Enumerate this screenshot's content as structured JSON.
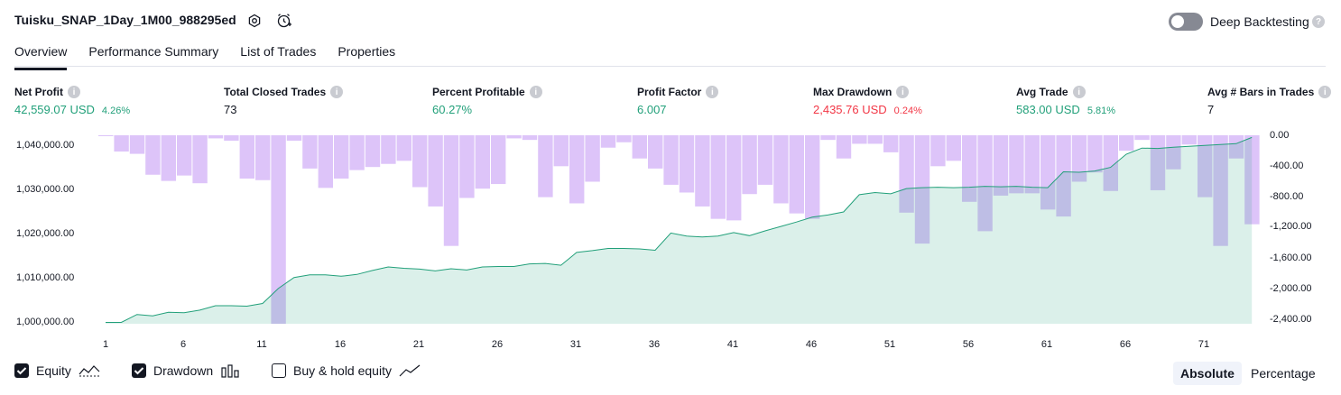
{
  "header": {
    "title": "Tuisku_SNAP_1Day_1M00_988295ed",
    "deep_backtesting_label": "Deep Backtesting",
    "deep_backtesting_on": false
  },
  "tabs": [
    {
      "label": "Overview",
      "active": true
    },
    {
      "label": "Performance Summary",
      "active": false
    },
    {
      "label": "List of Trades",
      "active": false
    },
    {
      "label": "Properties",
      "active": false
    }
  ],
  "metrics": [
    {
      "label": "Net Profit",
      "value": "42,559.07 USD",
      "pct": "4.26%",
      "color": "#22a07a"
    },
    {
      "label": "Total Closed Trades",
      "value": "73",
      "pct": "",
      "color": "#131722"
    },
    {
      "label": "Percent Profitable",
      "value": "60.27%",
      "pct": "",
      "color": "#22a07a"
    },
    {
      "label": "Profit Factor",
      "value": "6.007",
      "pct": "",
      "color": "#22a07a"
    },
    {
      "label": "Max Drawdown",
      "value": "2,435.76 USD",
      "pct": "0.24%",
      "color": "#f23645"
    },
    {
      "label": "Avg Trade",
      "value": "583.00 USD",
      "pct": "5.81%",
      "color": "#22a07a"
    },
    {
      "label": "Avg # Bars in Trades",
      "value": "7",
      "pct": "",
      "color": "#131722"
    }
  ],
  "chart_data": {
    "type": "line",
    "x_ticks": [
      "1",
      "6",
      "11",
      "16",
      "21",
      "26",
      "31",
      "36",
      "41",
      "46",
      "51",
      "56",
      "61",
      "66",
      "71"
    ],
    "y_left_ticks": [
      "1,040,000.00",
      "1,030,000.00",
      "1,020,000.00",
      "1,010,000.00",
      "1,000,000.00"
    ],
    "y_left_range": [
      999700,
      1042500
    ],
    "y_right_ticks": [
      "0.00",
      "-400.00",
      "-800.00",
      "-1,200.00",
      "-1,600.00",
      "-2,000.00",
      "-2,400.00"
    ],
    "y_right_range": [
      -2436,
      0
    ],
    "series": [
      {
        "name": "Equity",
        "color": "#22a07a",
        "x": [
          1,
          2,
          3,
          4,
          5,
          6,
          7,
          8,
          9,
          10,
          11,
          12,
          13,
          14,
          15,
          16,
          17,
          18,
          19,
          20,
          21,
          22,
          23,
          24,
          25,
          26,
          27,
          28,
          29,
          30,
          31,
          32,
          33,
          34,
          35,
          36,
          37,
          38,
          39,
          40,
          41,
          42,
          43,
          44,
          45,
          46,
          47,
          48,
          49,
          50,
          51,
          52,
          53,
          54,
          55,
          56,
          57,
          58,
          59,
          60,
          61,
          62,
          63,
          64,
          65,
          66,
          67,
          68,
          69,
          70,
          71,
          72,
          73,
          74
        ],
        "values": [
          1000000,
          1000000,
          1001800,
          1001500,
          1002300,
          1002200,
          1002800,
          1003800,
          1003800,
          1003700,
          1004300,
          1007700,
          1010200,
          1010800,
          1010800,
          1010500,
          1010900,
          1011800,
          1012600,
          1012300,
          1012100,
          1011700,
          1012200,
          1011900,
          1012600,
          1012700,
          1012700,
          1013300,
          1013400,
          1013000,
          1015900,
          1016300,
          1016800,
          1016800,
          1016700,
          1016400,
          1020300,
          1019600,
          1019400,
          1019600,
          1020400,
          1019700,
          1020800,
          1021800,
          1022800,
          1023900,
          1024400,
          1025100,
          1029000,
          1029500,
          1029200,
          1030400,
          1030600,
          1030700,
          1030600,
          1030700,
          1030900,
          1030800,
          1030900,
          1030700,
          1030600,
          1034200,
          1034100,
          1034400,
          1035200,
          1038200,
          1039600,
          1039500,
          1039800,
          1040000,
          1040200,
          1040400,
          1040600,
          1042000
        ]
      },
      {
        "name": "Drawdown",
        "color": "#c79cf5",
        "x": [
          1,
          2,
          3,
          4,
          5,
          6,
          7,
          8,
          9,
          10,
          11,
          12,
          13,
          14,
          15,
          16,
          17,
          18,
          19,
          20,
          21,
          22,
          23,
          24,
          25,
          26,
          27,
          28,
          29,
          30,
          31,
          32,
          33,
          34,
          35,
          36,
          37,
          38,
          39,
          40,
          41,
          42,
          43,
          44,
          45,
          46,
          47,
          48,
          49,
          50,
          51,
          52,
          53,
          54,
          55,
          56,
          57,
          58,
          59,
          60,
          61,
          62,
          63,
          64,
          65,
          66,
          67,
          68,
          69,
          70,
          71,
          72,
          73,
          74
        ],
        "values": [
          0,
          -210,
          -240,
          -510,
          -590,
          -520,
          -620,
          -40,
          -70,
          -560,
          -580,
          -2436,
          -70,
          -430,
          -680,
          -560,
          -450,
          -410,
          -370,
          -330,
          -670,
          -920,
          -1430,
          -810,
          -690,
          -630,
          -40,
          -60,
          -800,
          -400,
          -880,
          -600,
          -160,
          -90,
          -300,
          -430,
          -640,
          -740,
          -920,
          -1080,
          -1100,
          -760,
          -640,
          -880,
          -1010,
          -1080,
          -60,
          -300,
          -110,
          -110,
          -220,
          -1000,
          -1400,
          -400,
          -330,
          -860,
          -1240,
          -780,
          -750,
          -750,
          -960,
          -1050,
          -600,
          -480,
          -720,
          -200,
          -60,
          -710,
          -440,
          -120,
          -800,
          -1430,
          -300,
          -1150
        ]
      }
    ]
  },
  "legend": [
    {
      "label": "Equity",
      "checked": true,
      "icon": "equity-line-icon"
    },
    {
      "label": "Drawdown",
      "checked": true,
      "icon": "drawdown-bars-icon"
    },
    {
      "label": "Buy & hold equity",
      "checked": false,
      "icon": "buy-hold-line-icon"
    }
  ],
  "mode_toggle": {
    "absolute": "Absolute",
    "percentage": "Percentage",
    "active": "Absolute"
  }
}
